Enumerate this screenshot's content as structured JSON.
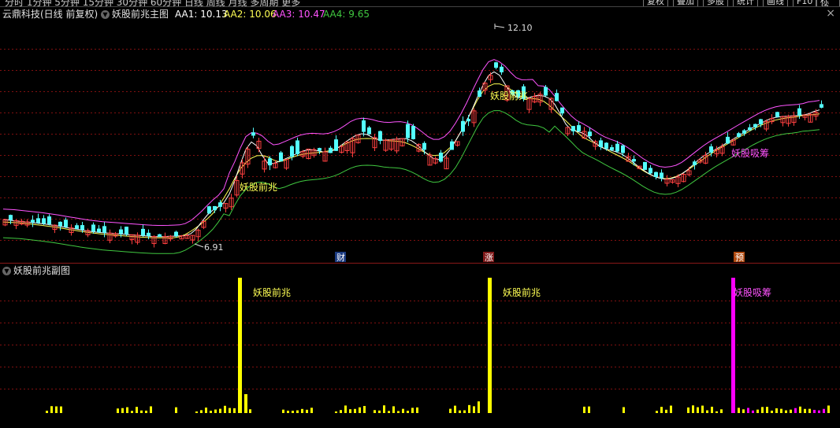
{
  "topbar": {
    "periods_text": "分时  1分钟  5分钟  15分钟  30分钟  60分钟  日线  周线  月线  多周期  更多",
    "buttons": [
      "复权",
      "叠加",
      "多股",
      "统计",
      "画线",
      "F10",
      "标记"
    ]
  },
  "header": {
    "stock": "云鼎科技(日线 前复权)",
    "indicator": "妖股前兆主图",
    "aa1": "AA1: 10.13",
    "aa2": "AA2: 10.06",
    "aa3": "AA3: 10.47",
    "aa4": "AA4: 9.65"
  },
  "colors": {
    "up": "#ff4040",
    "down": "#54ffff",
    "aa1": "#ffffff",
    "aa2": "#ffff54",
    "aa3": "#ff54ff",
    "aa4": "#40c840",
    "grid": "#801010",
    "signal_yellow": "#ffff00",
    "signal_magenta": "#ff00ff"
  },
  "main": {
    "high_label": "12.10",
    "low_label": "6.91",
    "signals": [
      "妖股前兆",
      "妖股前兆",
      "妖股吸筹"
    ],
    "event_tags": [
      "财",
      "涨",
      "预"
    ]
  },
  "sub": {
    "title": "妖股前兆副图",
    "labels": [
      "妖股前兆",
      "妖股前兆",
      "妖股吸筹"
    ]
  }
}
